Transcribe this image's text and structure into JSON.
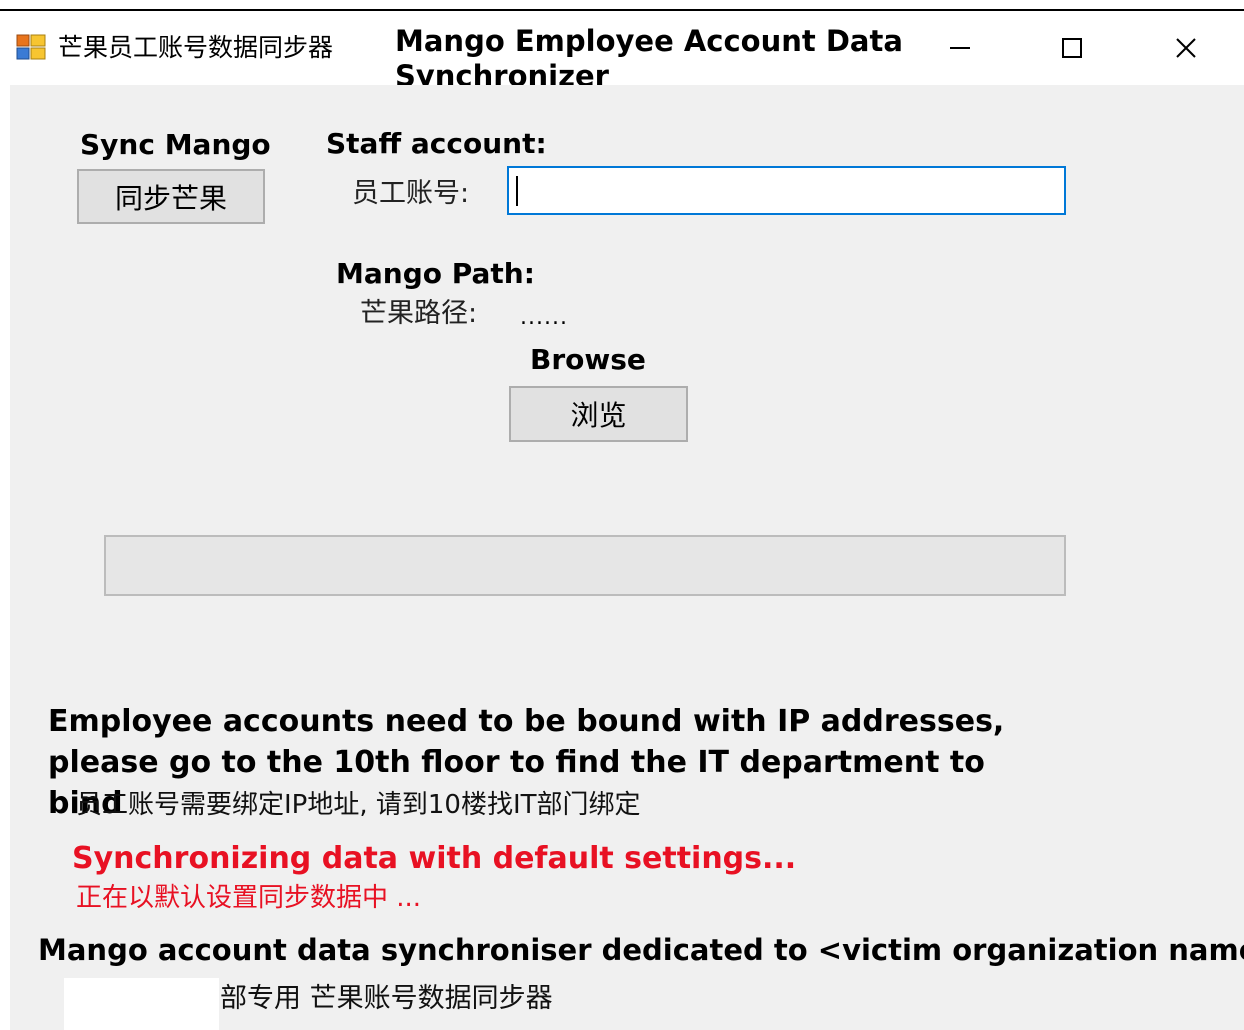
{
  "window": {
    "title_cn": "芒果员工账号数据同步器",
    "title_en": "Mango Employee Account Data Synchronizer",
    "controls": {
      "minimize": "—",
      "maximize": "☐",
      "close": "✕"
    }
  },
  "sync": {
    "label_en": "Sync Mango",
    "button_label": "同步芒果"
  },
  "staff": {
    "label_en": "Staff account:",
    "label_cn": "员工账号:",
    "value": ""
  },
  "path": {
    "label_en": "Mango Path:",
    "label_cn": "芒果路径:",
    "value": "......"
  },
  "browse": {
    "label_en": "Browse",
    "button_label": "浏览"
  },
  "progress": {
    "fraction": 0
  },
  "notice": {
    "en": "Employee accounts need to be bound with IP addresses, please go to the 10th floor to find the IT department to bind",
    "cn": "员工账号需要绑定IP地址, 请到10楼找IT部门绑定"
  },
  "status": {
    "en": "Synchronizing data with default settings...",
    "cn": "正在以默认设置同步数据中 ..."
  },
  "footer": {
    "en": "Mango account data synchroniser dedicated to <victim organization name>",
    "cn": "部专用 芒果账号数据同步器"
  },
  "colors": {
    "accent_blue": "#0078d7",
    "status_red": "#e81123",
    "client_bg": "#f0f0f0"
  }
}
